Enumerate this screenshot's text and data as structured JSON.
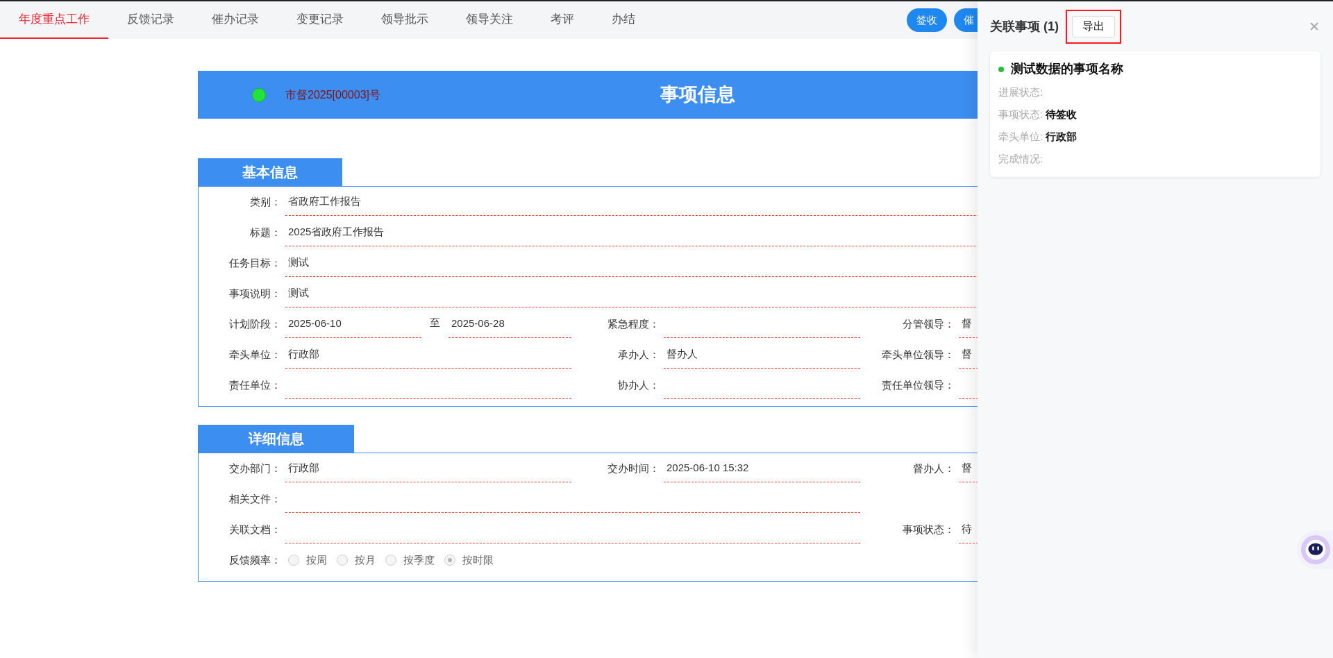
{
  "tabs": [
    {
      "label": "年度重点工作",
      "selected": true
    },
    {
      "label": "反馈记录",
      "selected": false
    },
    {
      "label": "催办记录",
      "selected": false
    },
    {
      "label": "变更记录",
      "selected": false
    },
    {
      "label": "领导批示",
      "selected": false
    },
    {
      "label": "领导关注",
      "selected": false
    },
    {
      "label": "考评",
      "selected": false
    },
    {
      "label": "办结",
      "selected": false
    }
  ],
  "toolbar_buttons": [
    "签收",
    "催"
  ],
  "header": {
    "code": "市督2025[00003]号",
    "title": "事项信息"
  },
  "sections": [
    {
      "title": "基本信息",
      "rows": [
        {
          "fields": [
            {
              "kind": "full",
              "label": "类别：",
              "value": "省政府工作报告"
            }
          ]
        },
        {
          "fields": [
            {
              "kind": "full",
              "label": "标题：",
              "value": "2025省政府工作报告"
            }
          ]
        },
        {
          "fields": [
            {
              "kind": "full",
              "label": "任务目标：",
              "value": "测试"
            }
          ]
        },
        {
          "fields": [
            {
              "kind": "full",
              "label": "事项说明：",
              "value": "测试"
            }
          ]
        },
        {
          "fields": [
            {
              "kind": "range",
              "label": "计划阶段：",
              "from": "2025-06-10",
              "separator": "至",
              "to": "2025-06-28"
            },
            {
              "kind": "short",
              "label": "紧急程度："
            },
            {
              "kind": "short",
              "label": "分管领导：",
              "value": "督"
            }
          ]
        },
        {
          "fields": [
            {
              "kind": "short",
              "label": "牵头单位：",
              "value": "行政部"
            },
            {
              "kind": "short",
              "label": "承办人：",
              "value": "督办人"
            },
            {
              "kind": "short",
              "label": "牵头单位领导：",
              "value": "督"
            }
          ]
        },
        {
          "fields": [
            {
              "kind": "short",
              "label": "责任单位："
            },
            {
              "kind": "short",
              "label": "协办人："
            },
            {
              "kind": "short",
              "label": "责任单位领导："
            }
          ]
        }
      ]
    },
    {
      "title": "详细信息",
      "rows": [
        {
          "fields": [
            {
              "kind": "short",
              "label": "交办部门：",
              "value": "行政部"
            },
            {
              "kind": "short",
              "label": "交办时间：",
              "value": "2025-06-10 15:32"
            },
            {
              "kind": "short",
              "label": "督办人：",
              "value": "督"
            }
          ]
        },
        {
          "fields": [
            {
              "kind": "wide",
              "label": "相关文件："
            }
          ]
        },
        {
          "fields": [
            {
              "kind": "wide",
              "label": "关联文档："
            },
            {
              "kind": "short",
              "label": "事项状态：",
              "value": "待"
            }
          ]
        },
        {
          "fields": [
            {
              "kind": "radio",
              "label": "反馈频率：",
              "options": [
                {
                  "label": "按周",
                  "selected": false
                },
                {
                  "label": "按月",
                  "selected": false
                },
                {
                  "label": "按季度",
                  "selected": false
                },
                {
                  "label": "按时限",
                  "selected": true
                }
              ]
            }
          ]
        }
      ]
    }
  ],
  "drawer": {
    "title": "关联事项 (1)",
    "export_button": {
      "label": "导出",
      "highlighted": true
    },
    "items": [
      {
        "title": "测试数据的事项名称",
        "color": "#22c03c",
        "fields": [
          {
            "label": "进展状态:"
          },
          {
            "label": "事项状态:",
            "value": "待签收"
          },
          {
            "label": "牵头单位:",
            "value": "行政部"
          },
          {
            "label": "完成情况:"
          }
        ]
      }
    ]
  }
}
